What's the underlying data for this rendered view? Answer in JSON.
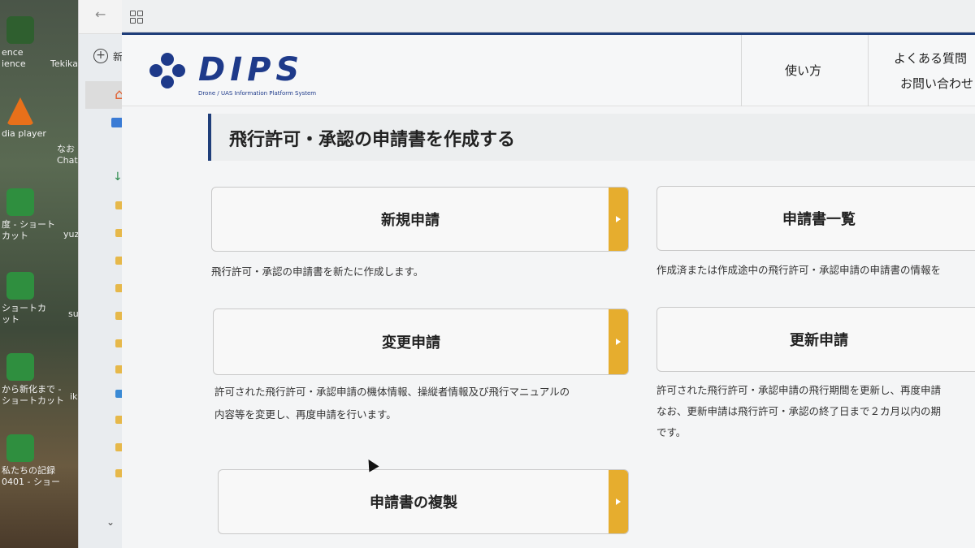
{
  "desktop": {
    "icons": [
      {
        "label": "ence\nience"
      },
      {
        "label": "dia player"
      },
      {
        "label": "度 - ショート\nカット"
      },
      {
        "label": "ショートカット"
      },
      {
        "label": "から新化まで -\nショートカット"
      },
      {
        "label": "私たちの記録\n0401 - ショー"
      }
    ],
    "right_labels": [
      "Tekikak",
      "なお\nChatG",
      "yuzu",
      "su",
      "ik"
    ]
  },
  "explorer": {
    "new_label": "新"
  },
  "site": {
    "logo": {
      "title": "DIPS",
      "subtitle": "Drone / UAS Information Platform System"
    },
    "nav": {
      "howto": "使い方",
      "faq": "よくある質問",
      "contact": "お問い合わせ"
    }
  },
  "page": {
    "title": "飛行許可・承認の申請書を作成する",
    "cards": {
      "new": {
        "label": "新規申請",
        "desc": "飛行許可・承認の申請書を新たに作成します。"
      },
      "list": {
        "label": "申請書一覧",
        "desc": "作成済または作成途中の飛行許可・承認申請の申請書の情報を"
      },
      "change": {
        "label": "変更申請",
        "desc1": "許可された飛行許可・承認申請の機体情報、操縦者情報及び飛行マニュアルの",
        "desc2": "内容等を変更し、再度申請を行います。"
      },
      "renew": {
        "label": "更新申請",
        "desc1": "許可された飛行許可・承認申請の飛行期間を更新し、再度申請",
        "desc2": "なお、更新申請は飛行許可・承認の終了日まで２カ月以内の期",
        "desc3": "です。"
      },
      "copy": {
        "label": "申請書の複製"
      }
    }
  },
  "colors": {
    "brand": "#1e3a8a",
    "accent": "#e6ad2e"
  }
}
